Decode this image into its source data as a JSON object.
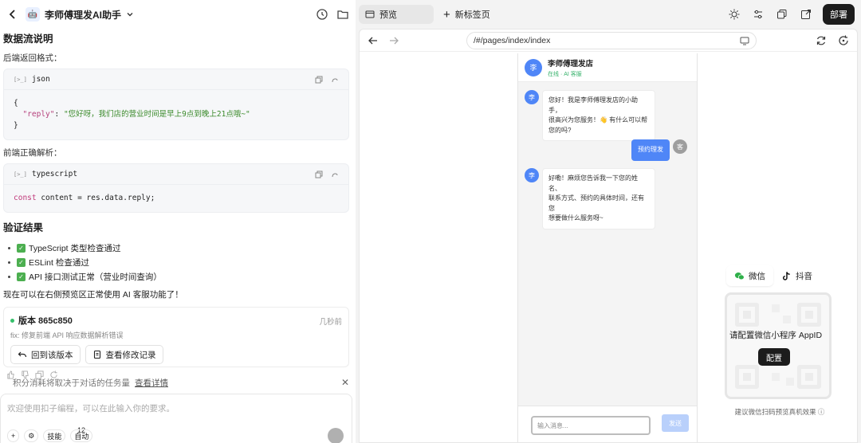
{
  "left": {
    "app_title": "李师傅理发AI助手",
    "app_logo_text": "🤖",
    "section1_title": "数据流说明",
    "backend_label": "后端返回格式：",
    "code1": {
      "lang_tag": "[>_]",
      "lang": "json",
      "line1": "{",
      "key": "\"reply\"",
      "colon": ": ",
      "value": "\"您好呀，我们店的营业时间是早上9点到晚上21点哦~\"",
      "line3": "}"
    },
    "frontend_label": "前端正确解析：",
    "code2": {
      "lang_tag": "[>_]",
      "lang": "typescript",
      "kw": "const",
      "rest": " content = res.data.reply;"
    },
    "section2_title": "验证结果",
    "checks": [
      "TypeScript 类型检查通过",
      "ESLint 检查通过",
      "API 接口测试正常（营业时间查询）"
    ],
    "check_mark": "✓",
    "note": "现在可以在右侧预览区正常使用 AI 客服功能了！",
    "version": {
      "title": "版本 865c850",
      "time": "几秒前",
      "desc": "fix: 修复前端 API 响应数据解析错误",
      "rollback_label": "回到该版本",
      "history_label": "查看修改记录"
    },
    "credit": {
      "text": "积分消耗将取决于对话的任务量",
      "link": "查看详情",
      "close": "✕"
    },
    "input": {
      "placeholder": "欢迎使用扣子编程，可以在此输入你的要求。",
      "chip1": "+",
      "chip2": "⚙",
      "chip3": "技能",
      "chip4": "自动",
      "badge": "12"
    }
  },
  "right": {
    "tab_preview": "预览",
    "new_tab": "新标签页",
    "new_tab_plus": "+",
    "deploy": "部署",
    "url": "/#/pages/index/index",
    "phone": {
      "shop_name": "李师傅理发店",
      "status": "在线 · AI 客服",
      "avatar_ai": "李",
      "avatar_user": "客",
      "msg1_l1": "您好！我是李师傅理发店的小助手，",
      "msg1_l2": "很高兴为您服务！👋 有什么可以帮",
      "msg1_l3": "您的吗?",
      "msg2": "预约理发",
      "msg3_l1": "好嘞！麻烦您告诉我一下您的姓名、",
      "msg3_l2": "联系方式、预约的具体时间，还有您",
      "msg3_l3": "想要做什么服务呀~",
      "input_placeholder": "输入消息...",
      "send": "发送"
    },
    "qr": {
      "tab_wechat": "微信",
      "tab_douyin": "抖音",
      "message": "请配置微信小程序 AppID",
      "config_button": "配置",
      "hint": "建议微信扫码预览真机效果 ⓘ"
    }
  }
}
